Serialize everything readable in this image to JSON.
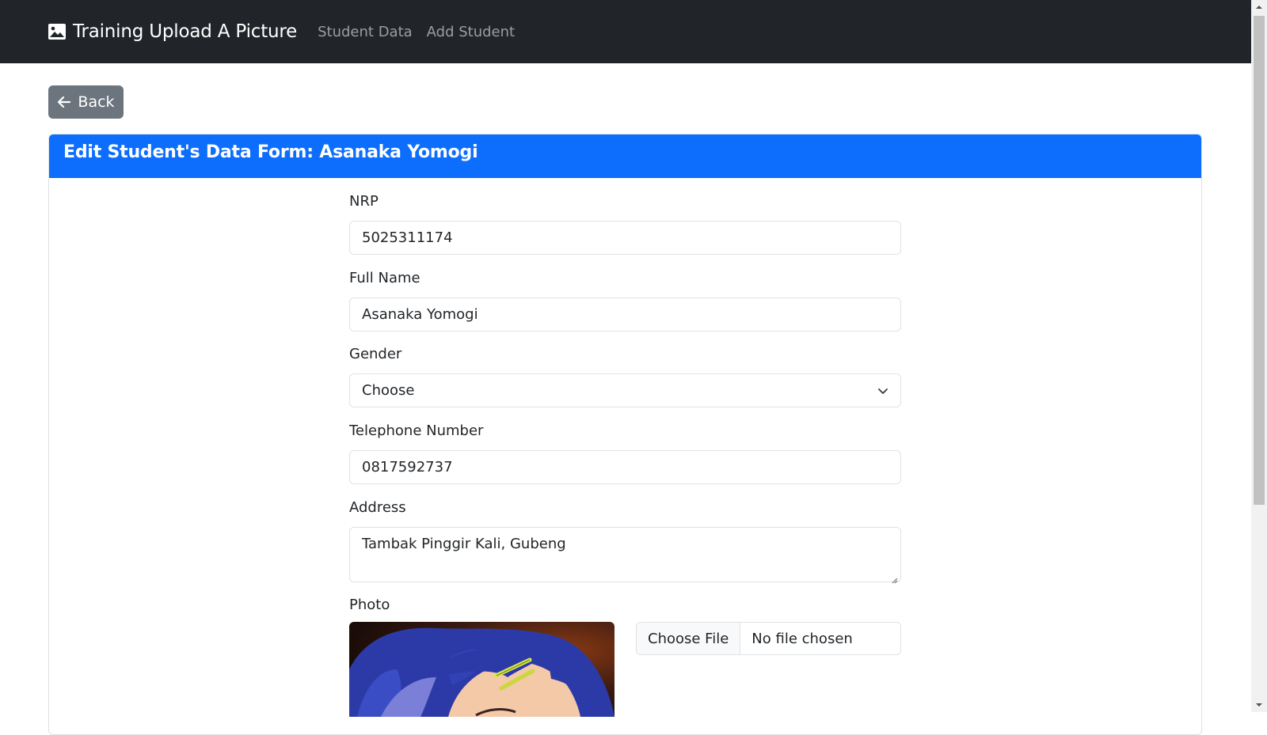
{
  "navbar": {
    "brand": "Training Upload A Picture",
    "brand_icon": "image-icon",
    "links": [
      "Student Data",
      "Add Student"
    ]
  },
  "back_button": {
    "label": "Back",
    "icon": "arrow-left-icon"
  },
  "card": {
    "title": "Edit Student's Data Form: Asanaka Yomogi"
  },
  "form": {
    "nrp": {
      "label": "NRP",
      "value": "5025311174"
    },
    "full_name": {
      "label": "Full Name",
      "value": "Asanaka Yomogi"
    },
    "gender": {
      "label": "Gender",
      "value": "Choose"
    },
    "telephone": {
      "label": "Telephone Number",
      "value": "0817592737"
    },
    "address": {
      "label": "Address",
      "value": "Tambak Pinggir Kali, Gubeng"
    },
    "photo": {
      "label": "Photo",
      "file_button": "Choose File",
      "file_status": "No file chosen"
    }
  },
  "colors": {
    "navbar_bg": "#212529",
    "primary": "#0d6efd",
    "secondary": "#6c757d"
  }
}
